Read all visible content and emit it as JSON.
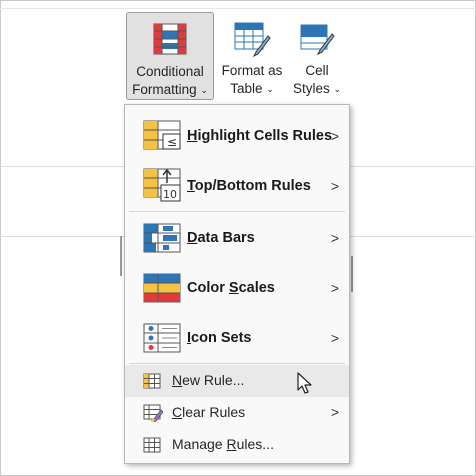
{
  "ribbon": {
    "conditional_formatting": {
      "line1": "Conditional",
      "line2": "Formatting",
      "chevron": "⌄"
    },
    "format_as_table": {
      "line1": "Format as",
      "line2": "Table",
      "chevron": "⌄"
    },
    "cell_styles": {
      "line1": "Cell",
      "line2": "Styles",
      "chevron": "⌄"
    }
  },
  "menu": {
    "items": [
      {
        "pre": "",
        "u": "H",
        "post": "ighlight Cells Rules",
        "icon": "highlight-cells-icon",
        "submenu": true
      },
      {
        "pre": "",
        "u": "T",
        "post": "op/Bottom Rules",
        "icon": "top-bottom-icon",
        "submenu": true
      },
      {
        "pre": "",
        "u": "D",
        "post": "ata Bars",
        "icon": "data-bars-icon",
        "submenu": true
      },
      {
        "pre": "Color ",
        "u": "S",
        "post": "cales",
        "icon": "color-scales-icon",
        "submenu": true
      },
      {
        "pre": "",
        "u": "I",
        "post": "con Sets",
        "icon": "icon-sets-icon",
        "submenu": true
      },
      {
        "pre": "",
        "u": "N",
        "post": "ew Rule...",
        "icon": "new-rule-icon",
        "submenu": false
      },
      {
        "pre": "",
        "u": "C",
        "post": "lear Rules",
        "icon": "clear-rules-icon",
        "submenu": true
      },
      {
        "pre": "Manage ",
        "u": "R",
        "post": "ules...",
        "icon": "manage-rules-icon",
        "submenu": false
      }
    ],
    "arrow": ">",
    "top_bottom_number": "10"
  },
  "colors": {
    "accent_blue": "#2e75b6",
    "red": "#e03a3a",
    "yellow": "#f5c242",
    "hover": "#e9e9e9"
  }
}
